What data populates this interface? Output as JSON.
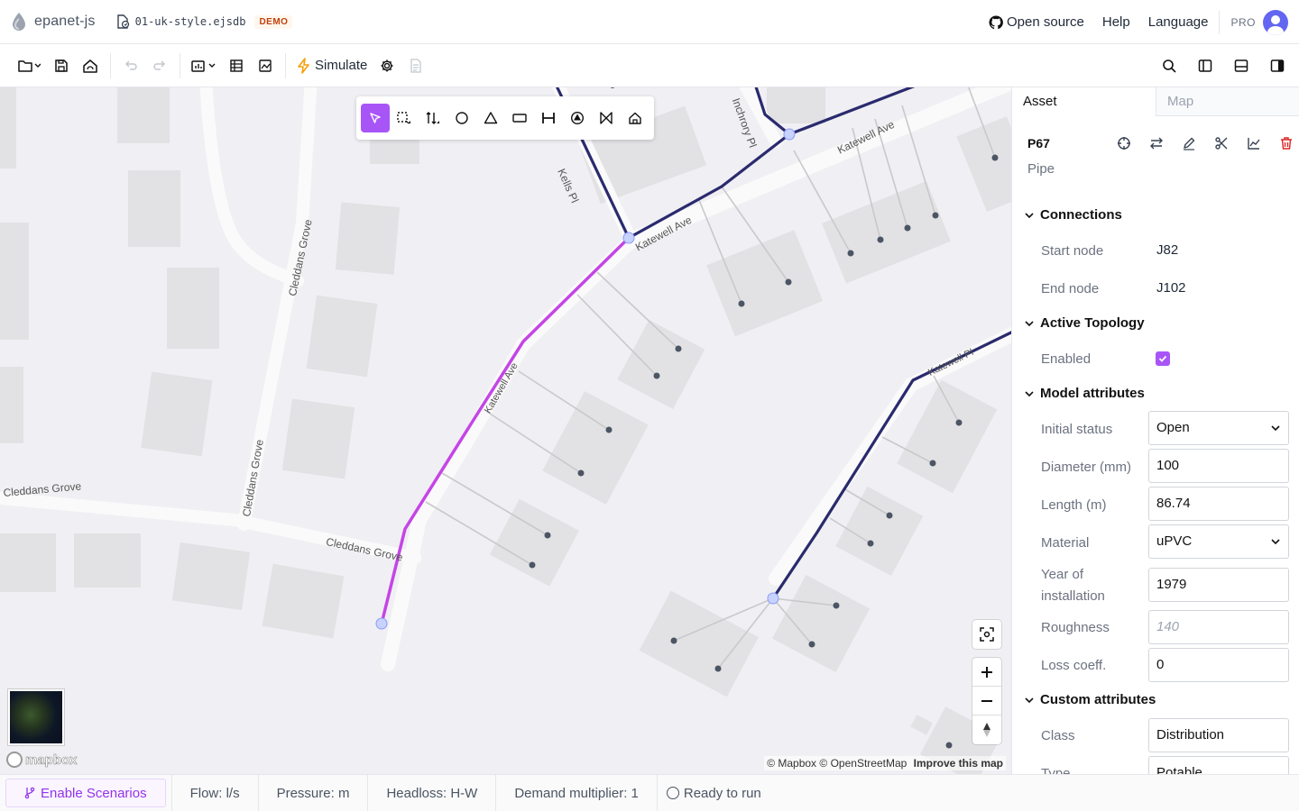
{
  "app": {
    "name": "epanet-js",
    "file_name": "01-uk-style.ejsdb",
    "badge": "DEMO"
  },
  "header": {
    "links": [
      "Open source",
      "Help",
      "Language"
    ],
    "plan": "PRO"
  },
  "toolbar": {
    "simulate_label": "Simulate"
  },
  "map": {
    "street_labels": [
      "Kells Pl",
      "Inchrory Pl",
      "Katewell Ave",
      "Katewell Ave",
      "Katewell Ave",
      "Katewell Pl",
      "Cleddans Grove",
      "Cleddans Grove",
      "Cleddans Grove",
      "Cleddans Grove"
    ],
    "attribution": {
      "mapbox": "© Mapbox",
      "osm": "© OpenStreetMap",
      "improve": "Improve this map"
    },
    "logo": "mapbox",
    "colors": {
      "selected_pipe": "#c445e6",
      "pipe": "#2a2a6e",
      "node": "#c7d2fe",
      "accent": "#a855f7"
    }
  },
  "draw_tools": [
    "select-icon",
    "lasso-select-icon",
    "drag-icon",
    "junction-icon",
    "reservoir-icon",
    "tank-icon",
    "pipe-icon",
    "pump-icon",
    "valve-icon",
    "customer-point-icon"
  ],
  "panel": {
    "tabs": [
      "Asset",
      "Map"
    ],
    "asset_id": "P67",
    "asset_type": "Pipe",
    "sections": {
      "connections": "Connections",
      "active_topology": "Active Topology",
      "model_attributes": "Model attributes",
      "custom_attributes": "Custom attributes"
    },
    "connections": {
      "start_label": "Start node",
      "start_value": "J82",
      "end_label": "End node",
      "end_value": "J102"
    },
    "topology": {
      "enabled_label": "Enabled",
      "enabled": true
    },
    "model": {
      "status_label": "Initial status",
      "status_value": "Open",
      "diameter_label": "Diameter (mm)",
      "diameter_value": "100",
      "length_label": "Length (m)",
      "length_value": "86.74",
      "material_label": "Material",
      "material_value": "uPVC",
      "year_label_1": "Year of",
      "year_label_2": "installation",
      "year_value": "1979",
      "roughness_label": "Roughness",
      "roughness_placeholder": "140",
      "loss_label": "Loss coeff.",
      "loss_value": "0"
    },
    "custom": {
      "class_label": "Class",
      "class_value": "Distribution",
      "type_label": "Type",
      "type_value": "Potable"
    }
  },
  "statusbar": {
    "scenarios": "Enable Scenarios",
    "flow": "Flow: l/s",
    "pressure": "Pressure: m",
    "headloss": "Headloss: H-W",
    "demand": "Demand multiplier: 1",
    "run_status": "Ready to run"
  }
}
